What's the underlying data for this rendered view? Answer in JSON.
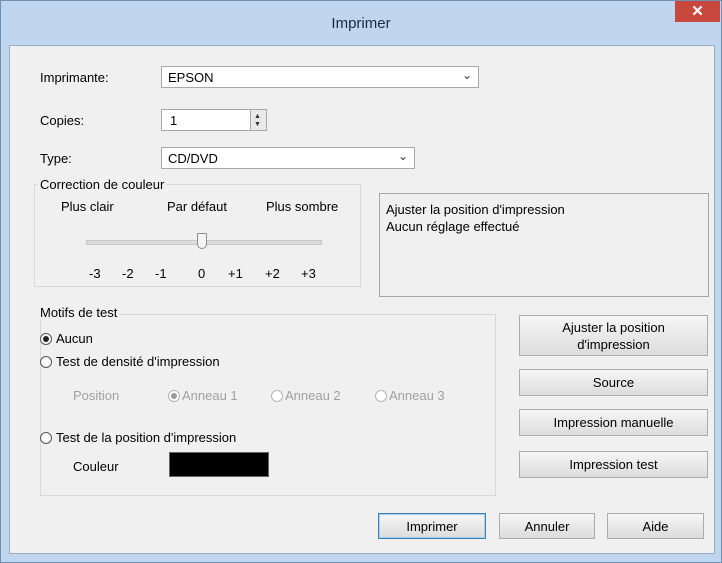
{
  "window": {
    "title": "Imprimer",
    "close_glyph": "✕"
  },
  "printer": {
    "label": "Imprimante:",
    "value": "EPSON"
  },
  "copies": {
    "label": "Copies:",
    "value": "1"
  },
  "type": {
    "label": "Type:",
    "value": "CD/DVD"
  },
  "color_correction": {
    "legend": "Correction de couleur",
    "lighter": "Plus clair",
    "default": "Par défaut",
    "darker": "Plus sombre",
    "ticks": [
      "-3",
      "-2",
      "-1",
      "0",
      "+1",
      "+2",
      "+3"
    ],
    "value": 0
  },
  "info": {
    "line1": "Ajuster la position d'impression",
    "line2": "Aucun réglage effectué"
  },
  "test_patterns": {
    "legend": "Motifs de test",
    "none": "Aucun",
    "density": "Test de densité d'impression",
    "position_label": "Position",
    "rings": [
      "Anneau 1",
      "Anneau 2",
      "Anneau 3"
    ],
    "print_position": "Test de la position d'impression",
    "color_label": "Couleur",
    "color_value": "#000000"
  },
  "side_buttons": {
    "adjust_line1": "Ajuster la position",
    "adjust_line2": "d'impression",
    "source": "Source",
    "manual": "Impression manuelle",
    "test": "Impression test"
  },
  "footer": {
    "print": "Imprimer",
    "cancel": "Annuler",
    "help": "Aide"
  }
}
